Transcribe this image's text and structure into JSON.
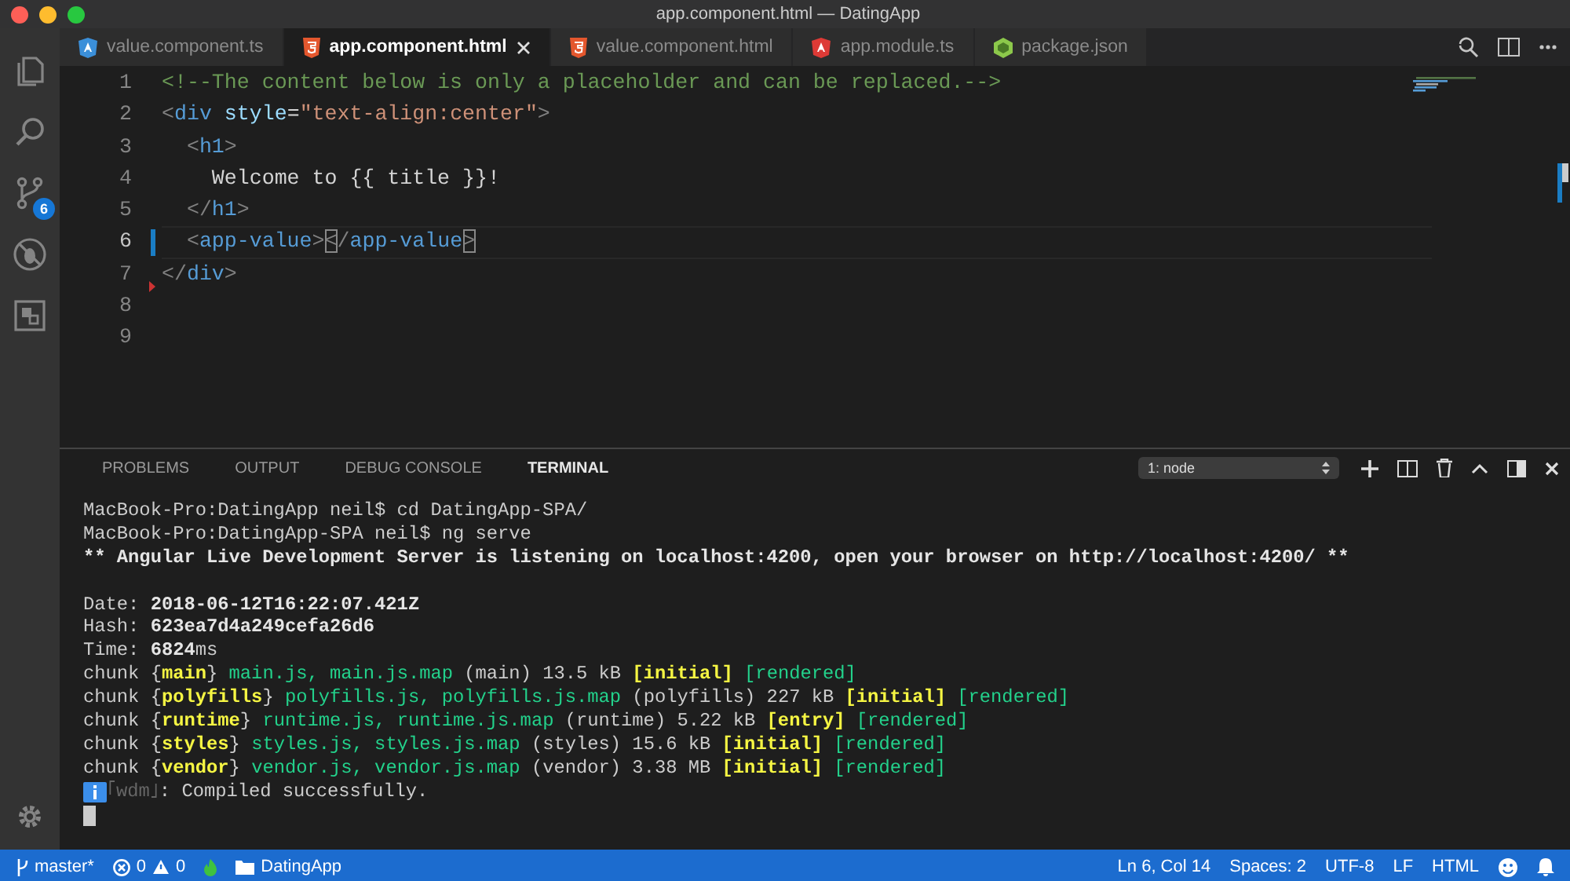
{
  "window": {
    "title": "app.component.html — DatingApp"
  },
  "activity_bar": {
    "items": [
      {
        "kind": "explorer",
        "selected": false
      },
      {
        "kind": "search",
        "selected": false
      },
      {
        "kind": "source-control",
        "selected": false,
        "badge": "6"
      },
      {
        "kind": "debug",
        "selected": false
      },
      {
        "kind": "extensions",
        "selected": false
      }
    ]
  },
  "tabs": [
    {
      "label": "value.component.ts",
      "kind": "component",
      "selected": false
    },
    {
      "label": "app.component.html",
      "kind": "html",
      "selected": true
    },
    {
      "label": "value.component.html",
      "kind": "html",
      "selected": false
    },
    {
      "label": "app.module.ts",
      "kind": "module",
      "selected": false
    },
    {
      "label": "package.json",
      "kind": "node",
      "selected": false
    }
  ],
  "editor": {
    "lines": [
      {
        "number": "1",
        "current": false,
        "deleted_marker": false,
        "tokens": [
          {
            "text": "<!--The content below is only a placeholder and can be replaced.-->",
            "kind": "comment"
          }
        ]
      },
      {
        "number": "2",
        "current": false,
        "deleted_marker": false,
        "tokens": [
          {
            "text": "<",
            "kind": "punct"
          },
          {
            "text": "div",
            "kind": "tag"
          },
          {
            "text": " style",
            "kind": "attr"
          },
          {
            "text": "=",
            "kind": "text"
          },
          {
            "text": "\"text-align:center\"",
            "kind": "string"
          },
          {
            "text": ">",
            "kind": "punct"
          }
        ]
      },
      {
        "number": "3",
        "current": false,
        "deleted_marker": false,
        "tokens": [
          {
            "text": "  <",
            "kind": "punct"
          },
          {
            "text": "h1",
            "kind": "tag"
          },
          {
            "text": ">",
            "kind": "punct"
          }
        ]
      },
      {
        "number": "4",
        "current": false,
        "deleted_marker": false,
        "tokens": [
          {
            "text": "    Welcome to {{ title }}!",
            "kind": "text"
          }
        ]
      },
      {
        "number": "5",
        "current": false,
        "deleted_marker": false,
        "tokens": [
          {
            "text": "  </",
            "kind": "punct"
          },
          {
            "text": "h1",
            "kind": "tag"
          },
          {
            "text": ">",
            "kind": "punct"
          }
        ]
      },
      {
        "number": "6",
        "current": true,
        "deleted_marker": false,
        "tokens": [
          {
            "text": "  <",
            "kind": "punct"
          },
          {
            "text": "app-value",
            "kind": "tag"
          },
          {
            "text": ">",
            "kind": "punct"
          },
          {
            "text": "<",
            "kind": "bracket-match"
          },
          {
            "text": "/",
            "kind": "punct"
          },
          {
            "text": "app-value",
            "kind": "tag"
          },
          {
            "text": ">",
            "kind": "bracket-match"
          }
        ]
      },
      {
        "number": "7",
        "current": false,
        "deleted_marker": true,
        "tokens": [
          {
            "text": "</",
            "kind": "punct"
          },
          {
            "text": "div",
            "kind": "tag"
          },
          {
            "text": ">",
            "kind": "punct"
          }
        ]
      },
      {
        "number": "8",
        "current": false
      },
      {
        "number": "9",
        "current": false
      }
    ]
  },
  "panel": {
    "tabs": [
      {
        "label": "PROBLEMS",
        "selected": false
      },
      {
        "label": "OUTPUT",
        "selected": false
      },
      {
        "label": "DEBUG CONSOLE",
        "selected": false
      },
      {
        "label": "TERMINAL",
        "selected": true
      }
    ],
    "terminal_select": "1: node",
    "terminal_lines": [
      {
        "kind": "text",
        "segments": [
          {
            "text": "MacBook-Pro:DatingApp neil$ cd DatingApp-SPA/",
            "kind": "plain"
          }
        ]
      },
      {
        "kind": "text",
        "segments": [
          {
            "text": "MacBook-Pro:DatingApp-SPA neil$ ng serve",
            "kind": "plain"
          }
        ]
      },
      {
        "kind": "text",
        "segments": [
          {
            "text": "** Angular Live Development Server is listening on localhost:4200, open your browser on http://localhost:4200/ **",
            "kind": "bold"
          }
        ]
      },
      {
        "kind": "blank"
      },
      {
        "kind": "text",
        "segments": [
          {
            "text": "Date: ",
            "kind": "plain"
          },
          {
            "text": "2018-06-12T16:22:07.421Z",
            "kind": "bold"
          }
        ]
      },
      {
        "kind": "text",
        "segments": [
          {
            "text": "Hash: ",
            "kind": "plain"
          },
          {
            "text": "623ea7d4a249cefa26d6",
            "kind": "bold"
          }
        ]
      },
      {
        "kind": "text",
        "segments": [
          {
            "text": "Time: ",
            "kind": "plain"
          },
          {
            "text": "6824",
            "kind": "bold"
          },
          {
            "text": "ms",
            "kind": "plain"
          }
        ]
      },
      {
        "kind": "text",
        "segments": [
          {
            "text": "chunk {",
            "kind": "plain"
          },
          {
            "text": "main",
            "kind": "yellow"
          },
          {
            "text": "} ",
            "kind": "plain"
          },
          {
            "text": "main.js, main.js.map",
            "kind": "green"
          },
          {
            "text": " (main) 13.5 kB ",
            "kind": "plain"
          },
          {
            "text": "[initial]",
            "kind": "yellow"
          },
          {
            "text": " [rendered]",
            "kind": "green"
          }
        ]
      },
      {
        "kind": "text",
        "segments": [
          {
            "text": "chunk {",
            "kind": "plain"
          },
          {
            "text": "polyfills",
            "kind": "yellow"
          },
          {
            "text": "} ",
            "kind": "plain"
          },
          {
            "text": "polyfills.js, polyfills.js.map",
            "kind": "green"
          },
          {
            "text": " (polyfills) 227 kB ",
            "kind": "plain"
          },
          {
            "text": "[initial]",
            "kind": "yellow"
          },
          {
            "text": " [rendered]",
            "kind": "green"
          }
        ]
      },
      {
        "kind": "text",
        "segments": [
          {
            "text": "chunk {",
            "kind": "plain"
          },
          {
            "text": "runtime",
            "kind": "yellow"
          },
          {
            "text": "} ",
            "kind": "plain"
          },
          {
            "text": "runtime.js, runtime.js.map",
            "kind": "green"
          },
          {
            "text": " (runtime) 5.22 kB ",
            "kind": "plain"
          },
          {
            "text": "[entry]",
            "kind": "yellow"
          },
          {
            "text": " [rendered]",
            "kind": "green"
          }
        ]
      },
      {
        "kind": "text",
        "segments": [
          {
            "text": "chunk {",
            "kind": "plain"
          },
          {
            "text": "styles",
            "kind": "yellow"
          },
          {
            "text": "} ",
            "kind": "plain"
          },
          {
            "text": "styles.js, styles.js.map",
            "kind": "green"
          },
          {
            "text": " (styles) 15.6 kB ",
            "kind": "plain"
          },
          {
            "text": "[initial]",
            "kind": "yellow"
          },
          {
            "text": " [rendered]",
            "kind": "green"
          }
        ]
      },
      {
        "kind": "text",
        "segments": [
          {
            "text": "chunk {",
            "kind": "plain"
          },
          {
            "text": "vendor",
            "kind": "yellow"
          },
          {
            "text": "} ",
            "kind": "plain"
          },
          {
            "text": "vendor.js, vendor.js.map",
            "kind": "green"
          },
          {
            "text": " (vendor) 3.38 MB ",
            "kind": "plain"
          },
          {
            "text": "[initial]",
            "kind": "yellow"
          },
          {
            "text": " [rendered]",
            "kind": "green"
          }
        ]
      },
      {
        "kind": "info",
        "segments": [
          {
            "text": "｢wdm｣",
            "kind": "dim"
          },
          {
            "text": ": Compiled successfully.",
            "kind": "plain"
          }
        ]
      },
      {
        "kind": "cursor"
      }
    ]
  },
  "status_bar": {
    "branch": "master*",
    "errors": "0",
    "warnings": "0",
    "folder": "DatingApp",
    "position": "Ln 6, Col 14",
    "indentation": "Spaces: 2",
    "encoding": "UTF-8",
    "line_ending": "LF",
    "language": "HTML"
  }
}
